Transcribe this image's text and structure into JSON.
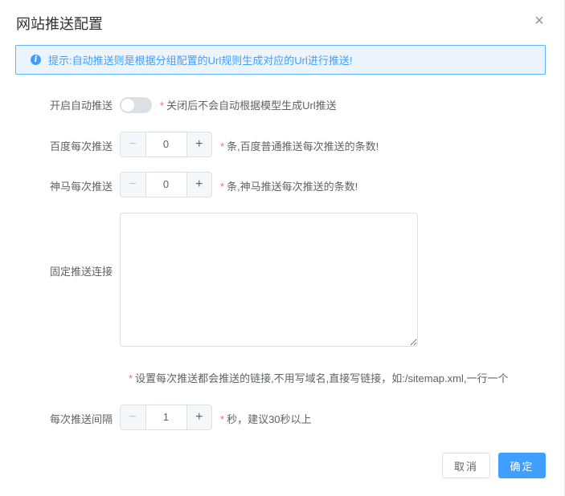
{
  "dialog": {
    "title": "网站推送配置",
    "close_icon": "×"
  },
  "alert": {
    "icon": "i",
    "text": "提示:自动推送则是根据分组配置的Url规则生成对应的Url进行推送!"
  },
  "form": {
    "auto_push": {
      "label": "开启自动推送",
      "enabled": false,
      "hint_star": "*",
      "hint": "关闭后不会自动根据模型生成Url推送"
    },
    "baidu": {
      "label": "百度每次推送",
      "value": "0",
      "minus": "−",
      "plus": "+",
      "hint_star": "*",
      "hint": "条,百度普通推送每次推送的条数!"
    },
    "shenma": {
      "label": "神马每次推送",
      "value": "0",
      "minus": "−",
      "plus": "+",
      "hint_star": "*",
      "hint": "条,神马推送每次推送的条数!"
    },
    "fixed_links": {
      "label": "固定推送连接",
      "value": "",
      "hint_star": "*",
      "hint": "设置每次推送都会推送的链接,不用写域名,直接写链接，如:/sitemap.xml,一行一个"
    },
    "interval": {
      "label": "每次推送间隔",
      "value": "1",
      "minus": "−",
      "plus": "+",
      "hint_star": "*",
      "hint": "秒，建议30秒以上"
    }
  },
  "footer": {
    "cancel_label": "取消",
    "ok_label": "确定"
  },
  "colors": {
    "primary": "#409eff",
    "required_star": "#f56c6c",
    "alert_bg": "#ecf5ff"
  }
}
